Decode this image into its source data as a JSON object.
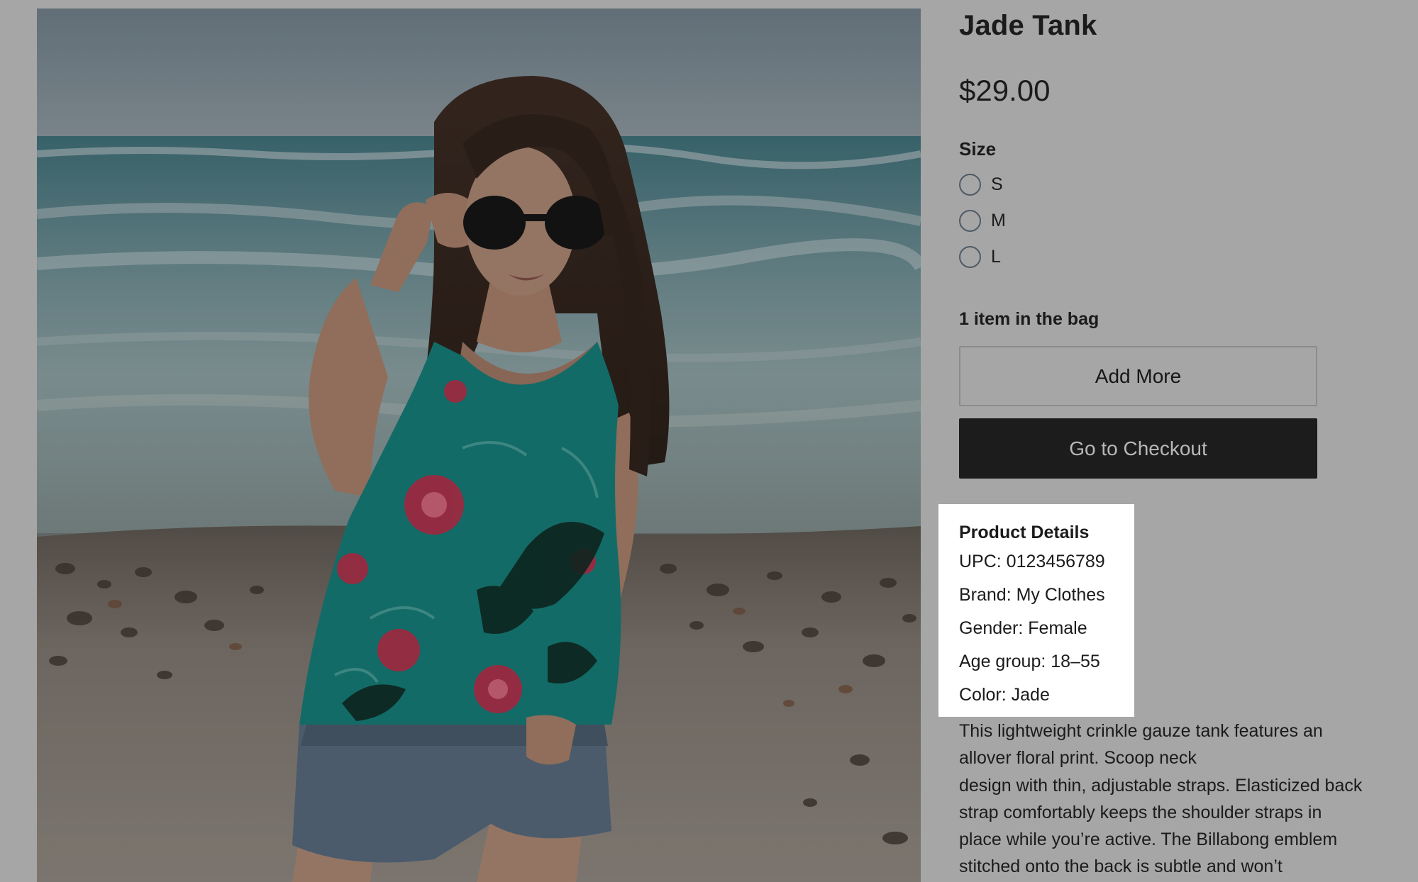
{
  "product": {
    "title": "Jade Tank",
    "price": "$29.00",
    "image_alt": "Woman in a jade floral tank top and denim shorts wearing sunglasses on a pebbly beach"
  },
  "size": {
    "label": "Size",
    "options": [
      "S",
      "M",
      "L"
    ]
  },
  "bag": {
    "count_text": "1 item in the bag",
    "add_more_label": "Add More",
    "checkout_label": "Go to Checkout"
  },
  "details": {
    "title": "Product Details",
    "lines": [
      "UPC: 0123456789",
      "Brand: My Clothes",
      "Gender: Female",
      "Age group: 18–55",
      "Color: Jade"
    ]
  },
  "description": {
    "lines": [
      "This lightweight crinkle gauze tank features an",
      "allover floral print. Scoop neck",
      "design with thin, adjustable straps. Elasticized back",
      "strap comfortably keeps the shoulder straps in",
      "place while you’re active. The Billabong emblem",
      "stitched onto the back is subtle and won’t"
    ]
  },
  "colors": {
    "page_background": "#a6a6a6",
    "checkout_button": "#1c1c1c",
    "details_highlight": "#ffffff"
  }
}
